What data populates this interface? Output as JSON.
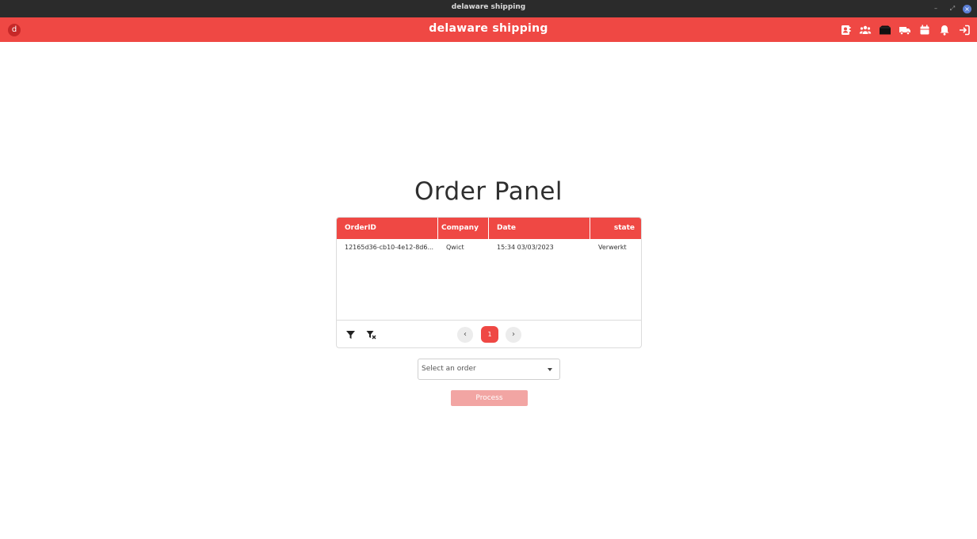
{
  "window": {
    "title": "delaware shipping",
    "controls": {
      "minimize": "–",
      "maximize": "⤢",
      "close": "×"
    }
  },
  "header": {
    "logo_letter": "d",
    "title": "delaware shipping",
    "icons": [
      "contact-card-icon",
      "users-icon",
      "box-icon",
      "truck-icon",
      "calendar-icon",
      "bell-icon",
      "logout-icon"
    ]
  },
  "main": {
    "title": "Order Panel",
    "table": {
      "columns": [
        "OrderID",
        "Company",
        "Date",
        "state"
      ],
      "rows": [
        [
          "12165d36-cb10-4e12-8d6...",
          "Qwict",
          "15:34 03/03/2023",
          "Verwerkt"
        ]
      ],
      "pagination": {
        "prev": "‹",
        "current": "1",
        "next": "›"
      }
    },
    "order_select": {
      "placeholder": "Select an order"
    },
    "process_button": "Process"
  },
  "colors": {
    "brand": "#ef4844",
    "button_disabled": "#f2a5a3"
  }
}
